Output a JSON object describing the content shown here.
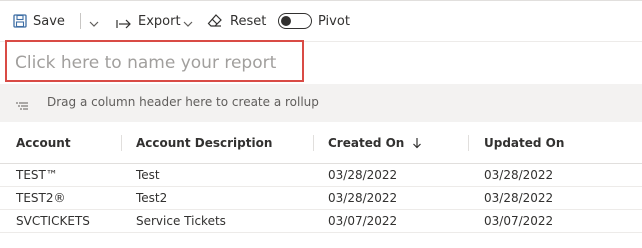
{
  "toolbar": {
    "save_label": "Save",
    "export_label": "Export",
    "reset_label": "Reset",
    "pivot_label": "Pivot",
    "pivot_on": false
  },
  "report_name": {
    "placeholder": "Click here to name your report",
    "value": ""
  },
  "rollup": {
    "hint": "Drag a column header here to create a rollup"
  },
  "grid": {
    "columns": [
      {
        "label": "Account"
      },
      {
        "label": "Account Description"
      },
      {
        "label": "Created On",
        "sort": "descending"
      },
      {
        "label": "Updated On"
      }
    ],
    "rows": [
      [
        "TEST™",
        "Test",
        "03/28/2022",
        "03/28/2022"
      ],
      [
        "TEST2®",
        "Test2",
        "03/28/2022",
        "03/28/2022"
      ],
      [
        "SVCTICKETS",
        "Service Tickets",
        "03/07/2022",
        "03/07/2022"
      ]
    ]
  },
  "colors": {
    "highlight_border": "#d94b45",
    "text": "#323130",
    "muted": "#a19f9d",
    "rollup_bg": "#f3f2f1"
  },
  "icons": [
    "save-icon",
    "chevron-down-icon",
    "export-icon",
    "eraser-icon",
    "toggle-switch",
    "rollup-icon",
    "sort-down-arrow-icon"
  ]
}
